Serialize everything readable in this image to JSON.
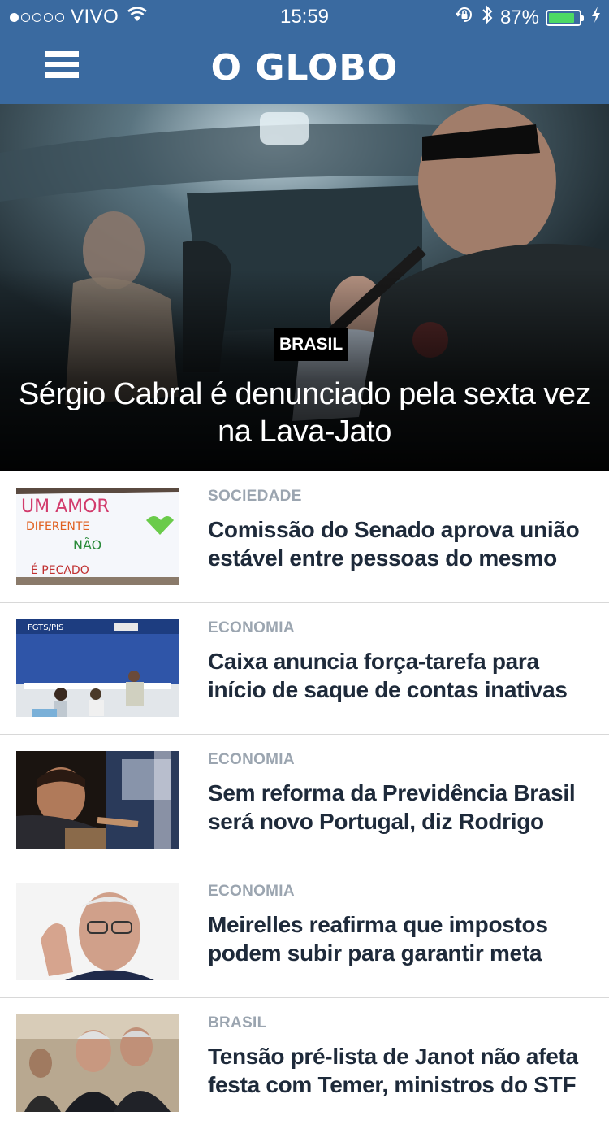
{
  "status_bar": {
    "carrier": "VIVO",
    "time": "15:59",
    "battery_percent": "87%",
    "battery_level": 0.87,
    "signal_bars_filled": 1,
    "signal_bars_total": 5,
    "icons": [
      "wifi-icon",
      "orientation-lock-icon",
      "bluetooth-icon",
      "battery-icon",
      "charging-icon"
    ]
  },
  "header": {
    "logo": "O GLOBO",
    "menu_icon": "hamburger-menu-icon",
    "bg_color": "#3a6aa0"
  },
  "hero": {
    "tag": "BRASIL",
    "title": "Sérgio Cabral é denunciado pela sexta vez na Lava-Jato"
  },
  "articles": [
    {
      "category": "SOCIEDADE",
      "headline": "Comissão do Senado aprova união estável entre pessoas do mesmo sexo"
    },
    {
      "category": "ECONOMIA",
      "headline": "Caixa anuncia força-tarefa para início de saque de contas inativas do FGTS"
    },
    {
      "category": "ECONOMIA",
      "headline": "Sem reforma da Previdência Brasil será novo Portugal, diz Rodrigo Maia"
    },
    {
      "category": "ECONOMIA",
      "headline": "Meirelles reafirma que impostos podem subir para garantir meta"
    },
    {
      "category": "BRASIL",
      "headline": "Tensão pré-lista de Janot não afeta festa com Temer, ministros do STF e"
    }
  ],
  "thumb_text": {
    "sign_line1": "UM AMOR",
    "sign_line2": "DIFERENTE",
    "sign_line3": "NÃO",
    "sign_line4": "É PECADO",
    "fgts_sign": "FGTS/PIS"
  }
}
